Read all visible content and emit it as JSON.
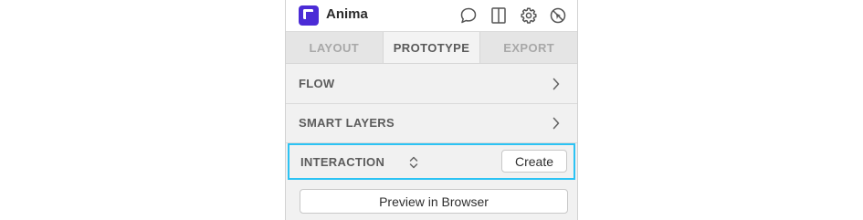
{
  "header": {
    "app_name": "Anima",
    "icons": [
      "logo-icon",
      "comment-icon",
      "panel-icon",
      "gear-icon",
      "disable-icon"
    ]
  },
  "tabs": [
    {
      "label": "LAYOUT",
      "active": false
    },
    {
      "label": "PROTOTYPE",
      "active": true
    },
    {
      "label": "EXPORT",
      "active": false
    }
  ],
  "rows": {
    "flow": "FLOW",
    "smart_layers": "SMART LAYERS",
    "interaction": "INTERACTION"
  },
  "buttons": {
    "create": "Create",
    "preview": "Preview in Browser"
  },
  "colors": {
    "brand": "#4b2bd6",
    "highlight": "#2cc3f4"
  }
}
